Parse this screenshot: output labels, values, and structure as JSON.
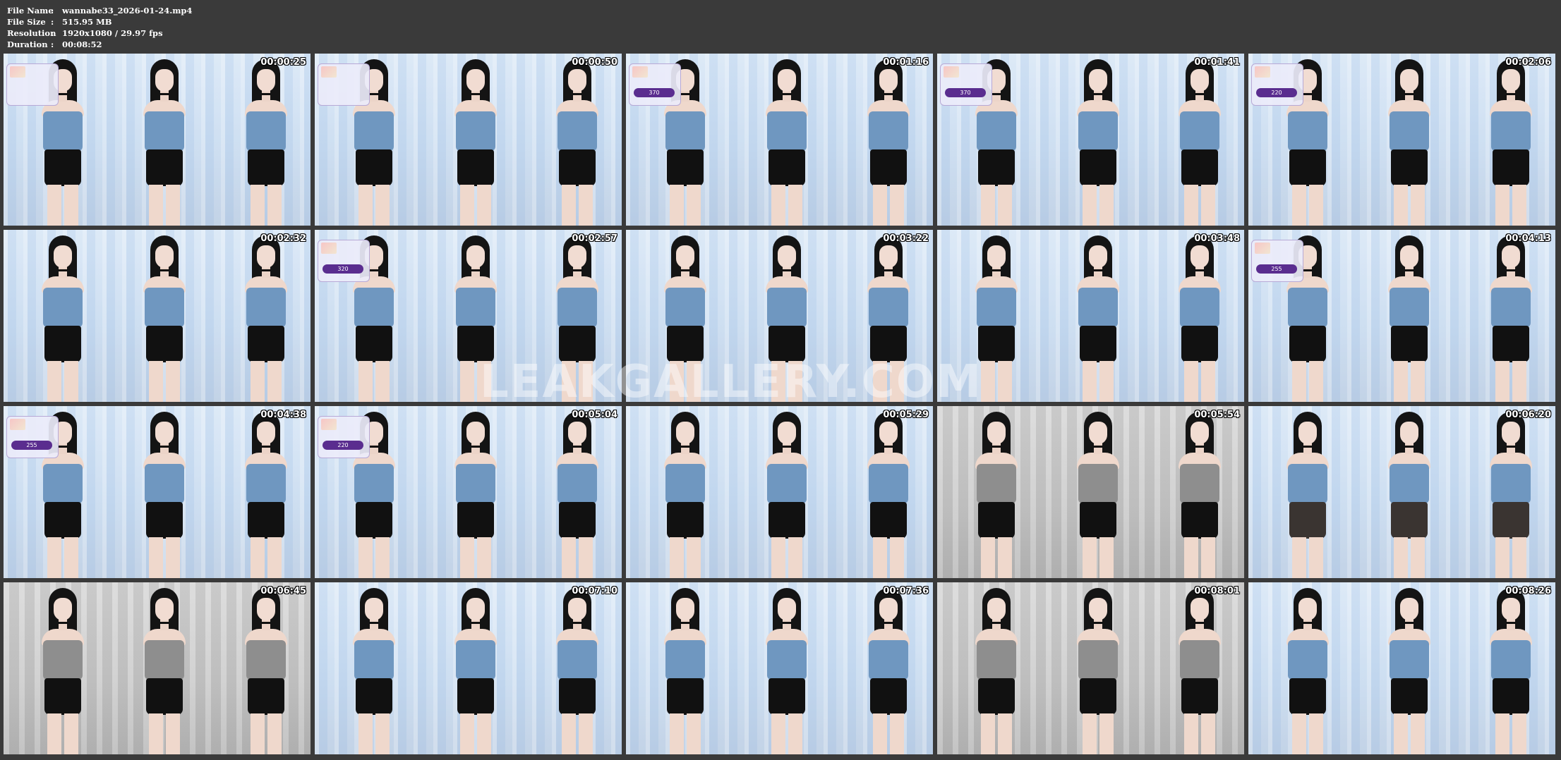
{
  "file_info": {
    "file_name_label": "File Name",
    "file_name_value": "wannabe33_2026-01-24.mp4",
    "file_size_label": "File Size",
    "file_size_value": "515.95 MB",
    "resolution_label": "Resolution",
    "resolution_value": "1920x1080 / 29.97 fps",
    "duration_label": "Duration",
    "duration_value": "00:08:52",
    "separator": ":"
  },
  "watermark": "LEAKGALLERY.COM",
  "colors": {
    "page_background": "#3a3a3a",
    "top_blue": "#6f97c0",
    "skirt_black": "#111111"
  },
  "thumbnails": [
    {
      "timestamp": "00:00:25",
      "wall": "blue",
      "overlay": "",
      "top": "blue",
      "skirt": "black"
    },
    {
      "timestamp": "00:00:50",
      "wall": "blue",
      "overlay": "",
      "top": "blue",
      "skirt": "black"
    },
    {
      "timestamp": "00:01:16",
      "wall": "blue",
      "overlay": "370",
      "top": "blue",
      "skirt": "black"
    },
    {
      "timestamp": "00:01:41",
      "wall": "blue",
      "overlay": "370",
      "top": "blue",
      "skirt": "black"
    },
    {
      "timestamp": "00:02:06",
      "wall": "blue",
      "overlay": "220",
      "top": "blue",
      "skirt": "black"
    },
    {
      "timestamp": "00:02:32",
      "wall": "blue",
      "overlay": "",
      "top": "blue",
      "skirt": "black"
    },
    {
      "timestamp": "00:02:57",
      "wall": "blue",
      "overlay": "320",
      "top": "blue",
      "skirt": "black"
    },
    {
      "timestamp": "00:03:22",
      "wall": "blue",
      "overlay": "",
      "top": "blue",
      "skirt": "black"
    },
    {
      "timestamp": "00:03:48",
      "wall": "blue",
      "overlay": "",
      "top": "blue",
      "skirt": "black"
    },
    {
      "timestamp": "00:04:13",
      "wall": "blue",
      "overlay": "255",
      "top": "blue",
      "skirt": "black"
    },
    {
      "timestamp": "00:04:38",
      "wall": "blue",
      "overlay": "255",
      "top": "blue",
      "skirt": "black"
    },
    {
      "timestamp": "00:05:04",
      "wall": "blue",
      "overlay": "220",
      "top": "blue",
      "skirt": "black"
    },
    {
      "timestamp": "00:05:29",
      "wall": "blue",
      "overlay": "",
      "top": "blue",
      "skirt": "black"
    },
    {
      "timestamp": "00:05:54",
      "wall": "gray",
      "overlay": "",
      "top": "gray",
      "skirt": "black"
    },
    {
      "timestamp": "00:06:20",
      "wall": "blue",
      "overlay": "",
      "top": "blue",
      "skirt": "sheer"
    },
    {
      "timestamp": "00:06:45",
      "wall": "gray",
      "overlay": "",
      "top": "gray",
      "skirt": "black"
    },
    {
      "timestamp": "00:07:10",
      "wall": "blue",
      "overlay": "",
      "top": "blue",
      "skirt": "black"
    },
    {
      "timestamp": "00:07:36",
      "wall": "blue",
      "overlay": "",
      "top": "blue",
      "skirt": "black"
    },
    {
      "timestamp": "00:08:01",
      "wall": "gray",
      "overlay": "",
      "top": "gray",
      "skirt": "black"
    },
    {
      "timestamp": "00:08:26",
      "wall": "blue",
      "overlay": "",
      "top": "blue",
      "skirt": "black"
    }
  ]
}
